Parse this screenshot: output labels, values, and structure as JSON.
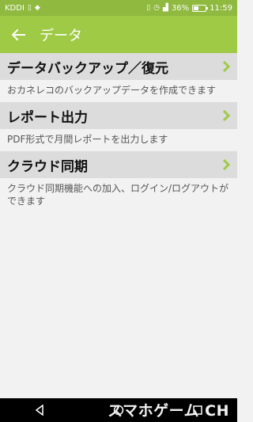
{
  "statusbar": {
    "carrier": "KDDI",
    "battery_percent": "36%",
    "battery_level": 0.36,
    "time": "11:59"
  },
  "appbar": {
    "title": "データ",
    "back_icon": "arrow-left-icon"
  },
  "items": [
    {
      "title": "データバックアップ／復元",
      "description": "おカネレコのバックアップデータを作成できます"
    },
    {
      "title": "レポート出力",
      "description": "PDF形式で月間レポートを出力します"
    },
    {
      "title": "クラウド同期",
      "description": "クラウド同期機能への加入、ログイン/ログアウトができます"
    }
  ],
  "watermark": "スマホゲーム CH",
  "colors": {
    "appbar": "#9fca46",
    "statusbar": "#8fb93f",
    "chevron": "#9fca46",
    "row_header": "#dcdcdc",
    "background": "#f2f2f2"
  }
}
